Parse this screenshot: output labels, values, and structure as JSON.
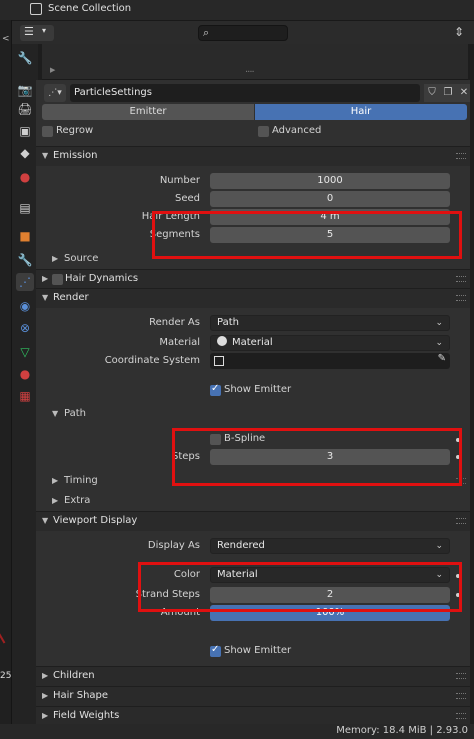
{
  "outliner": {
    "title": "Scene Collection"
  },
  "header": {
    "editor_glyph": "☰",
    "caret": "▾",
    "search_glyph": "⌕",
    "pin_glyph": "⇕"
  },
  "preview": {
    "dots": "....",
    "arrow": "▶"
  },
  "left_strip": {
    "chevron": "<",
    "number": "25"
  },
  "tabs": [
    {
      "name": "tool-tab-icon",
      "glyph": "🔧",
      "color": "#cfcfcf"
    },
    {
      "name": "render-tab-icon",
      "glyph": "📷",
      "color": "#cfcfcf"
    },
    {
      "name": "output-tab-icon",
      "glyph": "🖨",
      "color": "#cfcfcf"
    },
    {
      "name": "view-layer-tab-icon",
      "glyph": "▣",
      "color": "#cfcfcf"
    },
    {
      "name": "scene-tab-icon",
      "glyph": "◆",
      "color": "#cfcfcf"
    },
    {
      "name": "world-tab-icon",
      "glyph": "●",
      "color": "#d04040"
    },
    {
      "name": "collection-tab-icon",
      "glyph": "▤",
      "color": "#cfcfcf"
    },
    {
      "name": "object-tab-icon",
      "glyph": "■",
      "color": "#e08030"
    },
    {
      "name": "modifier-tab-icon",
      "glyph": "🔧",
      "color": "#5a8fd8"
    },
    {
      "name": "particles-tab-icon",
      "glyph": "⋰",
      "color": "#5a8fd8"
    },
    {
      "name": "physics-tab-icon",
      "glyph": "◉",
      "color": "#5a8fd8"
    },
    {
      "name": "constraints-tab-icon",
      "glyph": "⊗",
      "color": "#5a8fd8"
    },
    {
      "name": "data-tab-icon",
      "glyph": "▽",
      "color": "#30c060"
    },
    {
      "name": "material-tab-icon",
      "glyph": "●",
      "color": "#d04040"
    },
    {
      "name": "texture-tab-icon",
      "glyph": "▦",
      "color": "#d04040"
    }
  ],
  "datablock": {
    "name": "ParticleSettings",
    "icon": "⋰▾",
    "shield": "⛉",
    "copy": "❐",
    "close": "✕"
  },
  "type_tabs": {
    "emitter": "Emitter",
    "hair": "Hair"
  },
  "options": {
    "regrow": "Regrow",
    "advanced": "Advanced"
  },
  "emission": {
    "title": "Emission",
    "number_label": "Number",
    "number_value": "1000",
    "seed_label": "Seed",
    "seed_value": "0",
    "hair_length_label": "Hair Length",
    "hair_length_value": "4 m",
    "segments_label": "Segments",
    "segments_value": "5",
    "source_title": "Source"
  },
  "hair_dynamics": {
    "title": "Hair Dynamics"
  },
  "render": {
    "title": "Render",
    "render_as_label": "Render As",
    "render_as_value": "Path",
    "material_label": "Material",
    "material_value": "Material",
    "coord_label": "Coordinate System",
    "show_emitter": "Show Emitter",
    "path_title": "Path",
    "bspline": "B-Spline",
    "steps_label": "Steps",
    "steps_value": "3",
    "timing_title": "Timing",
    "extra_title": "Extra"
  },
  "viewport_display": {
    "title": "Viewport Display",
    "display_as_label": "Display As",
    "display_as_value": "Rendered",
    "color_label": "Color",
    "color_value": "Material",
    "strand_steps_label": "Strand Steps",
    "strand_steps_value": "2",
    "amount_label": "Amount",
    "amount_value": "100%",
    "show_emitter": "Show Emitter"
  },
  "collapsed": {
    "children": "Children",
    "hair_shape": "Hair Shape",
    "field_weights": "Field Weights"
  },
  "status": {
    "text": "Memory: 18.4 MiB | 2.93.0"
  },
  "colors": {
    "accent": "#4772b3",
    "highlight_box": "#e01010"
  }
}
